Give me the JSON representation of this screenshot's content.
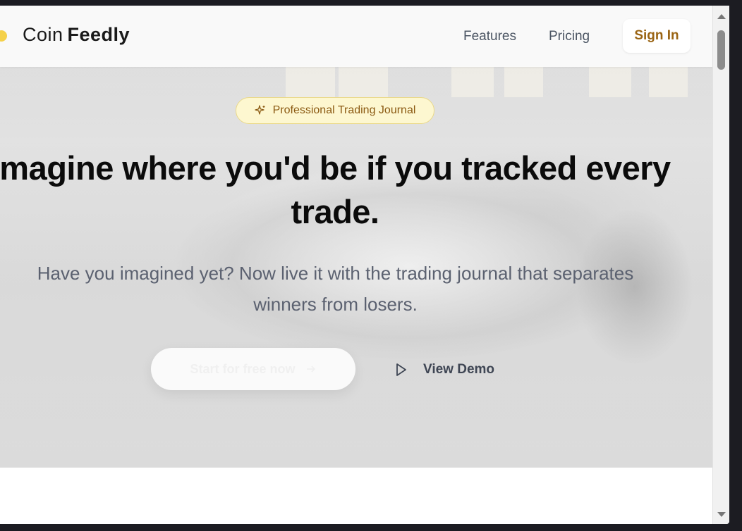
{
  "brand": {
    "part1": "Coin",
    "part2": "Feedly",
    "dot_color": "#f5d14a"
  },
  "nav": {
    "links": [
      {
        "label": "Features"
      },
      {
        "label": "Pricing"
      }
    ],
    "signin_label": "Sign In"
  },
  "hero": {
    "badge_label": "Professional Trading Journal",
    "badge_icon": "sparkle-icon",
    "headline_line1": "magine where you'd be if you tracked every",
    "headline_line2": "trade.",
    "subtext_line1": "Have you imagined yet? Now live it with the trading journal that separates",
    "subtext_line2": "winners from losers.",
    "cta_label": "Start for free now",
    "cta_icon": "arrow-right-icon",
    "demo_label": "View Demo",
    "demo_icon": "play-icon"
  },
  "colors": {
    "accent": "#9a6413",
    "badge_bg": "#fdf7d0",
    "text_muted": "#5b6170"
  }
}
